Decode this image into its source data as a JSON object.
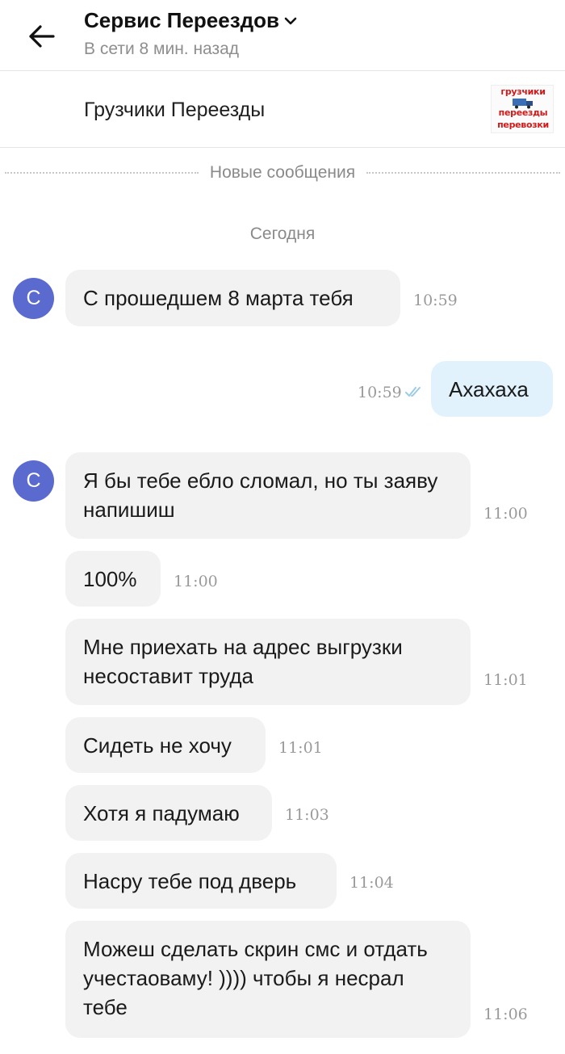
{
  "header": {
    "title": "Сервис Переездов",
    "status": "В сети 8 мин. назад"
  },
  "listing": {
    "title": "Грузчики Переезды",
    "thumb_lines": [
      "грузчики",
      "переезды",
      "перевозки"
    ]
  },
  "divider": {
    "label": "Новые сообщения"
  },
  "date_label": "Сегодня",
  "contact": {
    "avatar_letter": "С",
    "avatar_color": "#5a6acf"
  },
  "messages": [
    {
      "direction": "in",
      "text": "С прошедшем 8 марта тебя",
      "time": "10:59"
    },
    {
      "direction": "out",
      "text": "Ахахаха",
      "time": "10:59",
      "read": true
    },
    {
      "direction": "in",
      "text": "Я бы тебе ебло сломал, но ты заяву напишиш",
      "time": "11:00"
    },
    {
      "direction": "in",
      "text": "100%",
      "time": "11:00"
    },
    {
      "direction": "in",
      "text": "Мне приехать на адрес выгрузки несоставит труда",
      "time": "11:01"
    },
    {
      "direction": "in",
      "text": "Сидеть не хочу",
      "time": "11:01"
    },
    {
      "direction": "in",
      "text": "Хотя я падумаю",
      "time": "11:03"
    },
    {
      "direction": "in",
      "text": "Насру тебе под дверь",
      "time": "11:04"
    },
    {
      "direction": "in",
      "text": "Можеш сделать скрин смс и отдать учестаоваму! )))) чтобы я несрал тебе",
      "time": "11:06"
    }
  ],
  "colors": {
    "incoming_bubble": "#f2f2f2",
    "outgoing_bubble": "#e2f2fd",
    "read_ticks": "#9ccbe8"
  }
}
